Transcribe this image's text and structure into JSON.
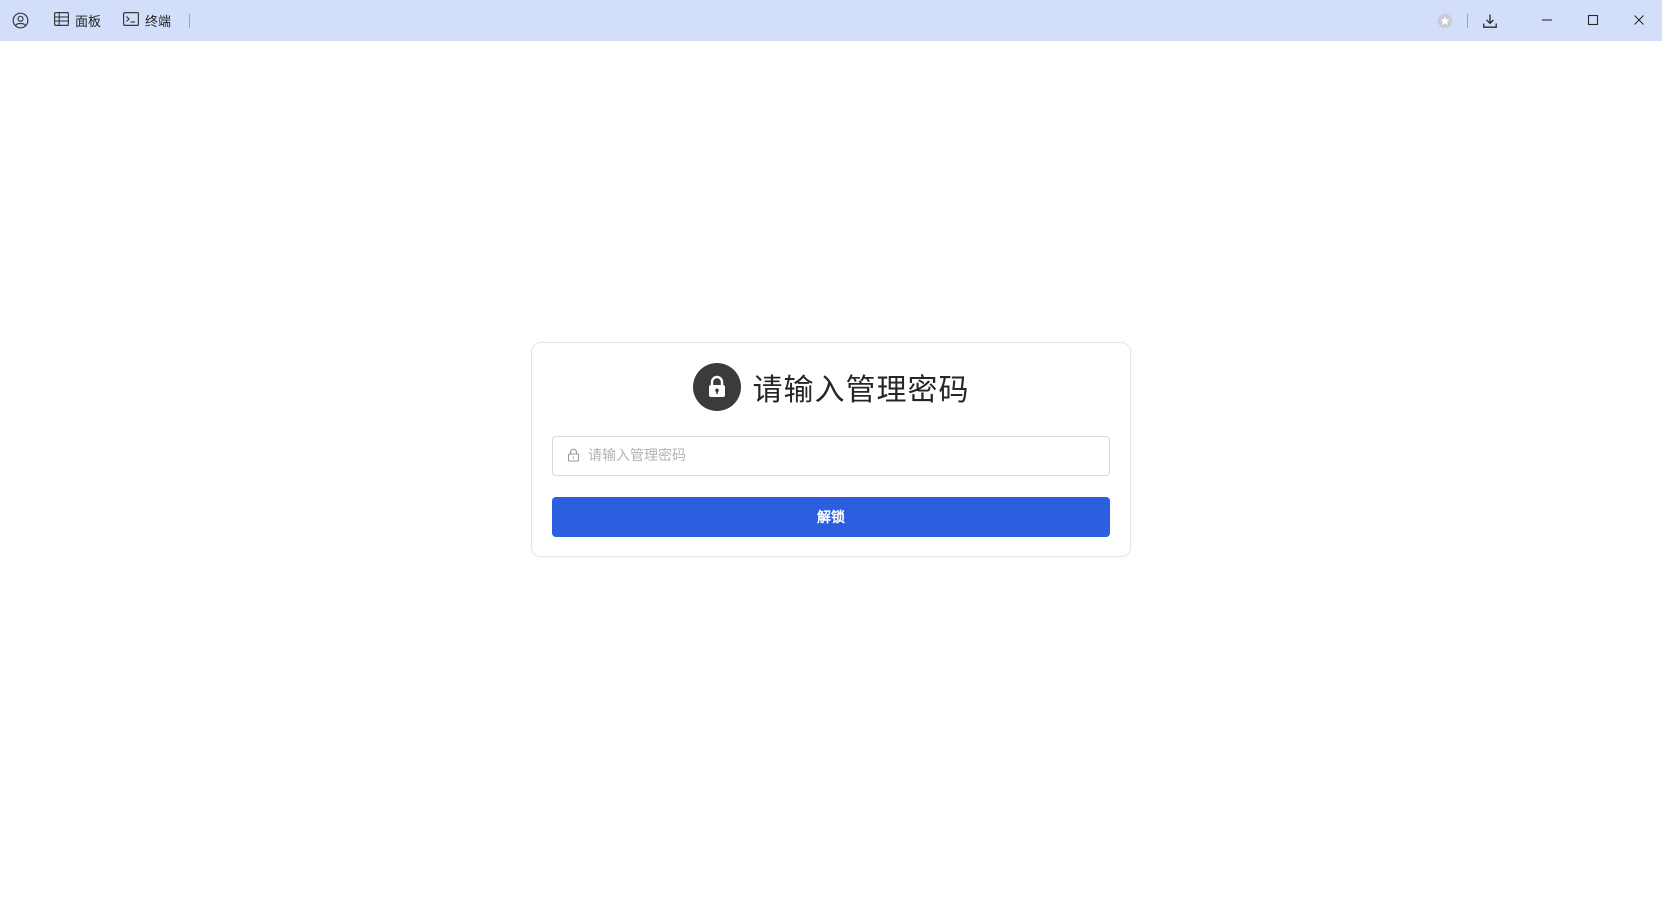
{
  "titlebar": {
    "background": "#d3dffa",
    "user_icon": "user-circle-icon",
    "tabs": [
      {
        "icon": "table-icon",
        "label": "面板"
      },
      {
        "icon": "terminal-icon",
        "label": "终端"
      }
    ],
    "right_icons": [
      "star-icon",
      "download-icon"
    ],
    "window_controls": [
      "minimize-icon",
      "maximize-icon",
      "close-icon"
    ]
  },
  "lock_dialog": {
    "icon": "lock-icon",
    "title": "请输入管理密码",
    "password": {
      "icon": "lock-outline-icon",
      "placeholder": "请输入管理密码",
      "value": ""
    },
    "unlock_label": "解锁",
    "accent_color": "#2b5fe0"
  }
}
